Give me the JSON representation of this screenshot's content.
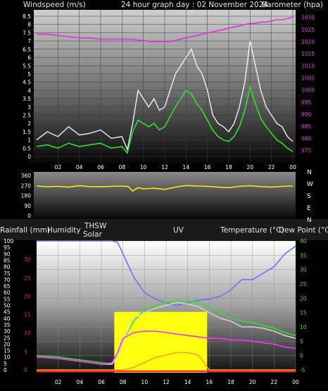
{
  "header": {
    "left": "Windspeed (m/s)",
    "center": "24 hour graph day : 02 November 2024",
    "right": "Barometer (hpa)",
    "rain": "Rainfall (mm)",
    "humidity": "Humidity",
    "thsw": "THSW",
    "solar": "Solar",
    "uv": "UV",
    "temp": "Temperature (°C)",
    "dew": "Dew Point (°C)"
  },
  "chart_data": [
    {
      "type": "line",
      "name": "wind-barometer",
      "x_ticks": [
        "02",
        "04",
        "06",
        "08",
        "10",
        "12",
        "14",
        "16",
        "18",
        "20",
        "22",
        "00"
      ],
      "y_left_ticks": [
        "0",
        "0.5",
        "1",
        "1.5",
        "2",
        "2.5",
        "3",
        "3.5",
        "4",
        "4.5",
        "5",
        "5.5",
        "6",
        "6.5",
        "7",
        "7.5",
        "8",
        "8.5"
      ],
      "y_right_ticks": [
        "975",
        "980",
        "985",
        "990",
        "995",
        "1000",
        "1005",
        "1010",
        "1015",
        "1020",
        "1025",
        "1030"
      ],
      "ylim_left": [
        0,
        8.8
      ],
      "ylim_right": [
        972.5,
        1032.5
      ],
      "x_hours": [
        0,
        1,
        2,
        3,
        4,
        5,
        6,
        7,
        8,
        8.5,
        9,
        9.5,
        10,
        10.5,
        11,
        11.5,
        12,
        12.5,
        13,
        13.5,
        14,
        14.5,
        15,
        15.5,
        16,
        16.5,
        17,
        17.5,
        18,
        18.5,
        19,
        19.5,
        20,
        20.5,
        21,
        21.5,
        22,
        22.5,
        23,
        23.5,
        24
      ],
      "series": [
        {
          "name": "gust",
          "color": "#f0f0f0",
          "values": [
            1.0,
            1.5,
            1.2,
            1.8,
            1.3,
            1.4,
            1.6,
            1.1,
            1.2,
            0.4,
            2.0,
            4.0,
            3.5,
            3.0,
            3.5,
            2.8,
            3.0,
            4.0,
            5.0,
            5.5,
            6.0,
            6.5,
            5.5,
            5.0,
            4.0,
            2.5,
            2.0,
            1.8,
            1.5,
            2.0,
            3.0,
            4.5,
            7.0,
            5.5,
            4.0,
            3.0,
            2.5,
            2.0,
            1.8,
            1.2,
            0.9
          ]
        },
        {
          "name": "speed",
          "color": "#30e030",
          "values": [
            0.6,
            0.7,
            0.5,
            0.8,
            0.6,
            0.7,
            0.8,
            0.5,
            0.6,
            0.2,
            1.5,
            2.2,
            2.0,
            1.8,
            2.0,
            1.6,
            1.8,
            2.4,
            3.0,
            3.5,
            4.0,
            3.8,
            3.2,
            2.8,
            2.2,
            1.6,
            1.2,
            1.0,
            0.9,
            1.2,
            1.8,
            2.8,
            4.2,
            3.2,
            2.3,
            1.8,
            1.4,
            1.0,
            0.8,
            0.5,
            0.3
          ]
        },
        {
          "name": "barometer",
          "color": "#e030e0",
          "values": [
            1023,
            1023,
            1022.5,
            1022,
            1021.5,
            1021.5,
            1021,
            1021,
            1021,
            1021,
            1021,
            1020.5,
            1020.5,
            1020,
            1020,
            1020,
            1020,
            1020,
            1020.5,
            1021,
            1021.5,
            1022,
            1022.5,
            1023,
            1023.5,
            1024,
            1024.5,
            1025,
            1025.5,
            1026,
            1026.5,
            1027,
            1027.5,
            1027.5,
            1028,
            1028,
            1028.5,
            1029,
            1029,
            1029.5,
            1030
          ]
        }
      ]
    },
    {
      "type": "line",
      "name": "wind-direction",
      "y_ticks": [
        "360",
        "270",
        "180",
        "90",
        "0"
      ],
      "dir_labels": [
        "N",
        "W",
        "S",
        "E",
        "N"
      ],
      "ylim": [
        0,
        360
      ],
      "x_hours": [
        0,
        1,
        2,
        3,
        4,
        5,
        6,
        7,
        8,
        8.6,
        9,
        9.5,
        10,
        11,
        12,
        13,
        14,
        15,
        16,
        17,
        18,
        19,
        20,
        21,
        22,
        23,
        24
      ],
      "series": [
        {
          "name": "direction",
          "color": "#f0f000",
          "values": [
            265,
            258,
            262,
            255,
            268,
            260,
            258,
            262,
            265,
            260,
            220,
            250,
            240,
            245,
            235,
            255,
            270,
            265,
            262,
            255,
            250,
            262,
            268,
            260,
            255,
            262,
            265
          ]
        }
      ]
    },
    {
      "type": "line",
      "name": "temp-humidity-solar",
      "x_ticks": [
        "02",
        "04",
        "06",
        "08",
        "10",
        "12",
        "14",
        "16",
        "18",
        "20",
        "22",
        "00"
      ],
      "y_humidity_ticks": [
        "0",
        "5",
        "10",
        "15",
        "20",
        "25",
        "30",
        "35",
        "40",
        "45",
        "50",
        "55",
        "60",
        "65",
        "70",
        "75",
        "80",
        "85",
        "90",
        "95",
        "100"
      ],
      "y_rain_ticks": [
        "0",
        "5",
        "10",
        "15",
        "20",
        "25",
        "30"
      ],
      "y_temp_ticks": [
        "-5",
        "0",
        "5",
        "10",
        "15",
        "20",
        "25",
        "30",
        "35",
        "40"
      ],
      "ylim_humidity": [
        0,
        100
      ],
      "ylim_temp": [
        -5,
        40
      ],
      "x_hours": [
        0,
        2,
        4,
        6,
        7,
        7.5,
        8,
        9,
        10,
        11,
        12,
        13,
        14,
        15,
        16,
        17,
        18,
        19,
        20,
        21,
        22,
        23,
        24
      ],
      "series": [
        {
          "name": "humidity",
          "color": "#7070ff",
          "values": [
            100,
            100,
            100,
            100,
            100,
            99,
            90,
            72,
            60,
            55,
            52,
            50,
            52,
            54,
            55,
            57,
            62,
            70,
            70,
            75,
            80,
            90,
            96
          ]
        },
        {
          "name": "temperature",
          "color": "#30e030",
          "values": [
            0,
            -0.5,
            -1.5,
            -2.5,
            -2.8,
            0,
            5,
            12,
            16,
            17.5,
            18.5,
            19,
            19,
            18.5,
            17,
            15,
            13,
            12,
            11.5,
            10.5,
            9.5,
            8,
            7
          ]
        },
        {
          "name": "thsw",
          "color": "#d0d0d0",
          "values": [
            -0.5,
            -1,
            -2,
            -3,
            -3,
            0,
            5,
            13,
            15,
            16.5,
            17.5,
            18.5,
            18,
            17,
            15,
            13,
            12,
            10,
            10,
            9.5,
            8.5,
            7,
            6
          ]
        },
        {
          "name": "dewpoint",
          "color": "#ff30ff",
          "values": [
            -0.5,
            -1,
            -2,
            -3,
            -2.5,
            1,
            6,
            8,
            8.5,
            8.5,
            8,
            7.5,
            7,
            6.5,
            6,
            6,
            5.5,
            5.5,
            5,
            4.5,
            4,
            3,
            2.5
          ]
        },
        {
          "name": "uv",
          "color": "#ffa020",
          "values": [
            0,
            0,
            0,
            0,
            0,
            0,
            0,
            0.5,
            1.5,
            2.5,
            3,
            3.5,
            3.5,
            3,
            0,
            0,
            0,
            0,
            0,
            0,
            0,
            0,
            0
          ]
        }
      ],
      "solar": {
        "start": 7.2,
        "end": 15.8,
        "level": 30,
        "color": "#ffff10"
      },
      "rainfall": {
        "values": [
          0,
          0,
          0,
          0,
          0,
          0,
          0,
          0,
          0,
          0,
          0,
          0
        ],
        "color": "#ff3020"
      }
    }
  ]
}
